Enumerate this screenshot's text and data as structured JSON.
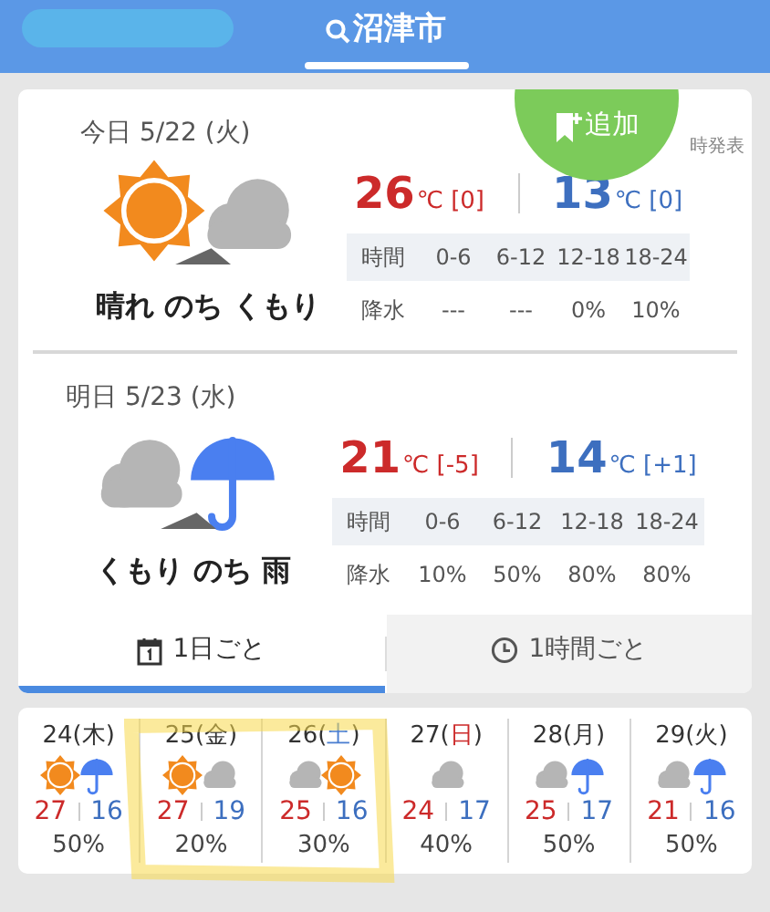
{
  "header": {
    "title": "沼津市"
  },
  "add_button": {
    "label": "追加"
  },
  "announce": "時発表",
  "days": [
    {
      "date": "今日 5/22 (火)",
      "icons": [
        {
          "kind": "sun"
        },
        {
          "kind": "cloud"
        }
      ],
      "summary": "晴れ のち くもり",
      "high": "26",
      "high_diff": "[0]",
      "low": "13",
      "low_diff": "[0]",
      "unit": "℃",
      "time_label": "時間",
      "slots": [
        "0-6",
        "6-12",
        "12-18",
        "18-24"
      ],
      "rain_label": "降水",
      "rain": [
        "---",
        "---",
        "0%",
        "10%"
      ]
    },
    {
      "date": "明日 5/23 (水)",
      "icons": [
        {
          "kind": "cloud"
        },
        {
          "kind": "umbrella"
        }
      ],
      "summary": "くもり のち 雨",
      "high": "21",
      "high_diff": "[-5]",
      "low": "14",
      "low_diff": "[+1]",
      "unit": "℃",
      "time_label": "時間",
      "slots": [
        "0-6",
        "6-12",
        "12-18",
        "18-24"
      ],
      "rain_label": "降水",
      "rain": [
        "10%",
        "50%",
        "80%",
        "80%"
      ]
    }
  ],
  "tabs": [
    {
      "label": "1日ごと",
      "selected": true
    },
    {
      "label": "1時間ごと",
      "selected": false
    }
  ],
  "week": [
    {
      "prefix": "24(",
      "weekday": "木",
      "suffix": ")",
      "color": "#333333",
      "icons": [
        {
          "kind": "sun"
        },
        {
          "kind": "umbrella"
        }
      ],
      "high": "27",
      "low": "16",
      "rain": "50%"
    },
    {
      "prefix": "25(",
      "weekday": "金",
      "suffix": ")",
      "color": "#333333",
      "icons": [
        {
          "kind": "sun"
        },
        {
          "kind": "cloud"
        }
      ],
      "high": "27",
      "low": "19",
      "rain": "20%"
    },
    {
      "prefix": "26(",
      "weekday": "土",
      "suffix": ")",
      "color": "#4a7ed0",
      "icons": [
        {
          "kind": "cloud"
        },
        {
          "kind": "sun"
        }
      ],
      "high": "25",
      "low": "16",
      "rain": "30%"
    },
    {
      "prefix": "27(",
      "weekday": "日",
      "suffix": ")",
      "color": "#cc2a2a",
      "icons": [
        {
          "kind": "cloud"
        }
      ],
      "high": "24",
      "low": "17",
      "rain": "40%"
    },
    {
      "prefix": "28(",
      "weekday": "月",
      "suffix": ")",
      "color": "#333333",
      "icons": [
        {
          "kind": "cloud"
        },
        {
          "kind": "umbrella"
        }
      ],
      "high": "25",
      "low": "17",
      "rain": "50%"
    },
    {
      "prefix": "29(",
      "weekday": "火",
      "suffix": ")",
      "color": "#333333",
      "icons": [
        {
          "kind": "cloud"
        },
        {
          "kind": "umbrella"
        }
      ],
      "high": "21",
      "low": "16",
      "rain": "50%"
    }
  ]
}
